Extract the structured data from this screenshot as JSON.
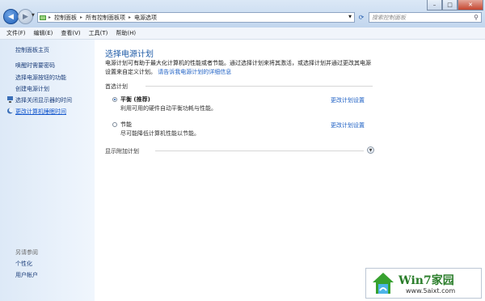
{
  "address": {
    "crumbs": [
      "控制面板",
      "所有控制面板项",
      "电源选项"
    ]
  },
  "search": {
    "placeholder": "搜索控制面板"
  },
  "menu": [
    "文件(F)",
    "编辑(E)",
    "查看(V)",
    "工具(T)",
    "帮助(H)"
  ],
  "sidebar": {
    "home": "控制面板主页",
    "items": [
      "唤醒时需要密码",
      "选择电源按钮的功能",
      "创建电源计划",
      "选择关闭显示器的时间",
      "更改计算机睡眠时间"
    ],
    "see_also_header": "另请参阅",
    "see_also": [
      "个性化",
      "用户帐户"
    ]
  },
  "main": {
    "title": "选择电源计划",
    "description": "电源计划可有助于最大化计算机的性能或者节能。通过选择计划来将其激活，或选择计划并通过更改其电源设置来自定义计划。",
    "description_link": "请告诉我电源计划的详细信息",
    "preferred_header": "首选计划",
    "plans": [
      {
        "name": "平衡 (推荐)",
        "desc": "利用可用的硬件自动平衡功耗与性能。",
        "link": "更改计划设置",
        "selected": true
      },
      {
        "name": "节能",
        "desc": "尽可能降低计算机性能以节能。",
        "link": "更改计划设置",
        "selected": false
      }
    ],
    "extra_header": "显示附加计划"
  },
  "watermark": {
    "title": "Win7家园",
    "url": "www.5aixt.com"
  },
  "colors": {
    "accent": "#1d5aa6",
    "link": "#1c5fc4",
    "close": "#c4452f"
  }
}
